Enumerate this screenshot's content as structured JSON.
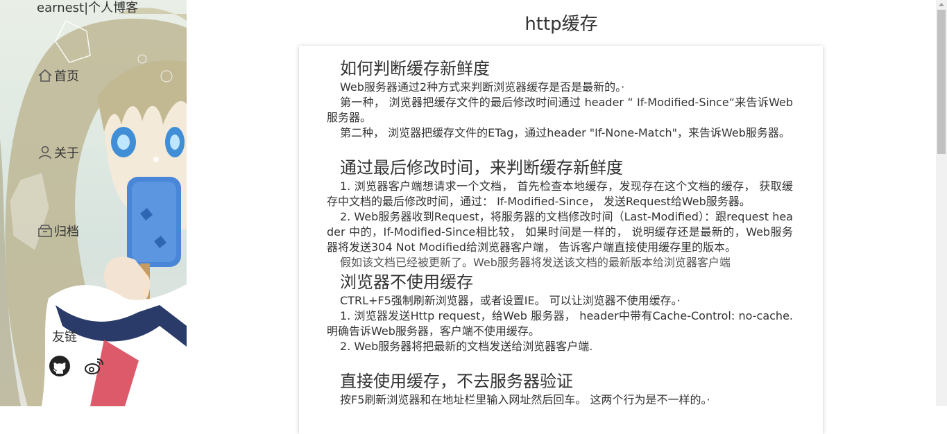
{
  "sidebar": {
    "site_title": "earnest|个人博客",
    "nav": [
      {
        "label": "首页",
        "icon": "home-icon"
      },
      {
        "label": "关于",
        "icon": "user-icon"
      },
      {
        "label": "归档",
        "icon": "archive-icon"
      }
    ],
    "friends_label": "友链",
    "friend_links": [
      {
        "icon": "github-icon"
      },
      {
        "icon": "weibo-icon"
      }
    ]
  },
  "article": {
    "title": "http缓存",
    "sections": [
      {
        "heading": "如何判断缓存新鲜度",
        "paragraphs": [
          "Web服务器通过2种方式来判断浏览器缓存是否是最新的。·",
          "第一种， 浏览器把缓存文件的最后修改时间通过 header “ If-Modified-Since“来告诉Web服务器。",
          "第二种， 浏览器把缓存文件的ETag，通过header \"If-None-Match\"，来告诉Web服务器。"
        ]
      },
      {
        "heading": "通过最后修改时间，来判断缓存新鲜度",
        "paragraphs": [
          "1. 浏览器客户端想请求一个文档， 首先检查本地缓存，发现存在这个文档的缓存， 获取缓存中文档的最后修改时间，通过： If-Modified-Since， 发送Request给Web服务器。",
          "2. Web服务器收到Request，将服务器的文档修改时间（Last-Modified）：跟request header 中的，If-Modified-Since相比较， 如果时间是一样的， 说明缓存还是最新的，Web服务器将发送304 Not Modified给浏览器客户端， 告诉客户端直接使用缓存里的版本。",
          "假如该文档已经被更新了。Web服务器将发送该文档的最新版本给浏览器客户端"
        ]
      },
      {
        "heading": "浏览器不使用缓存",
        "paragraphs": [
          "CTRL+F5强制刷新浏览器，或者设置IE。 可以让浏览器不使用缓存。·",
          "1. 浏览器发送Http request，给Web 服务器， header中带有Cache-Control: no-cache. 明确告诉Web服务器，客户端不使用缓存。",
          "2. Web服务器将把最新的文档发送给浏览器客户端."
        ]
      },
      {
        "heading": "直接使用缓存，不去服务器验证",
        "paragraphs": [
          "按F5刷新浏览器和在地址栏里输入网址然后回车。 这两个行为是不一样的。·"
        ]
      }
    ]
  },
  "colors": {
    "text": "#333333",
    "card_bg": "#ffffff",
    "scrollbar_track": "#f1f1f1",
    "scrollbar_thumb": "#c1c1c1"
  }
}
